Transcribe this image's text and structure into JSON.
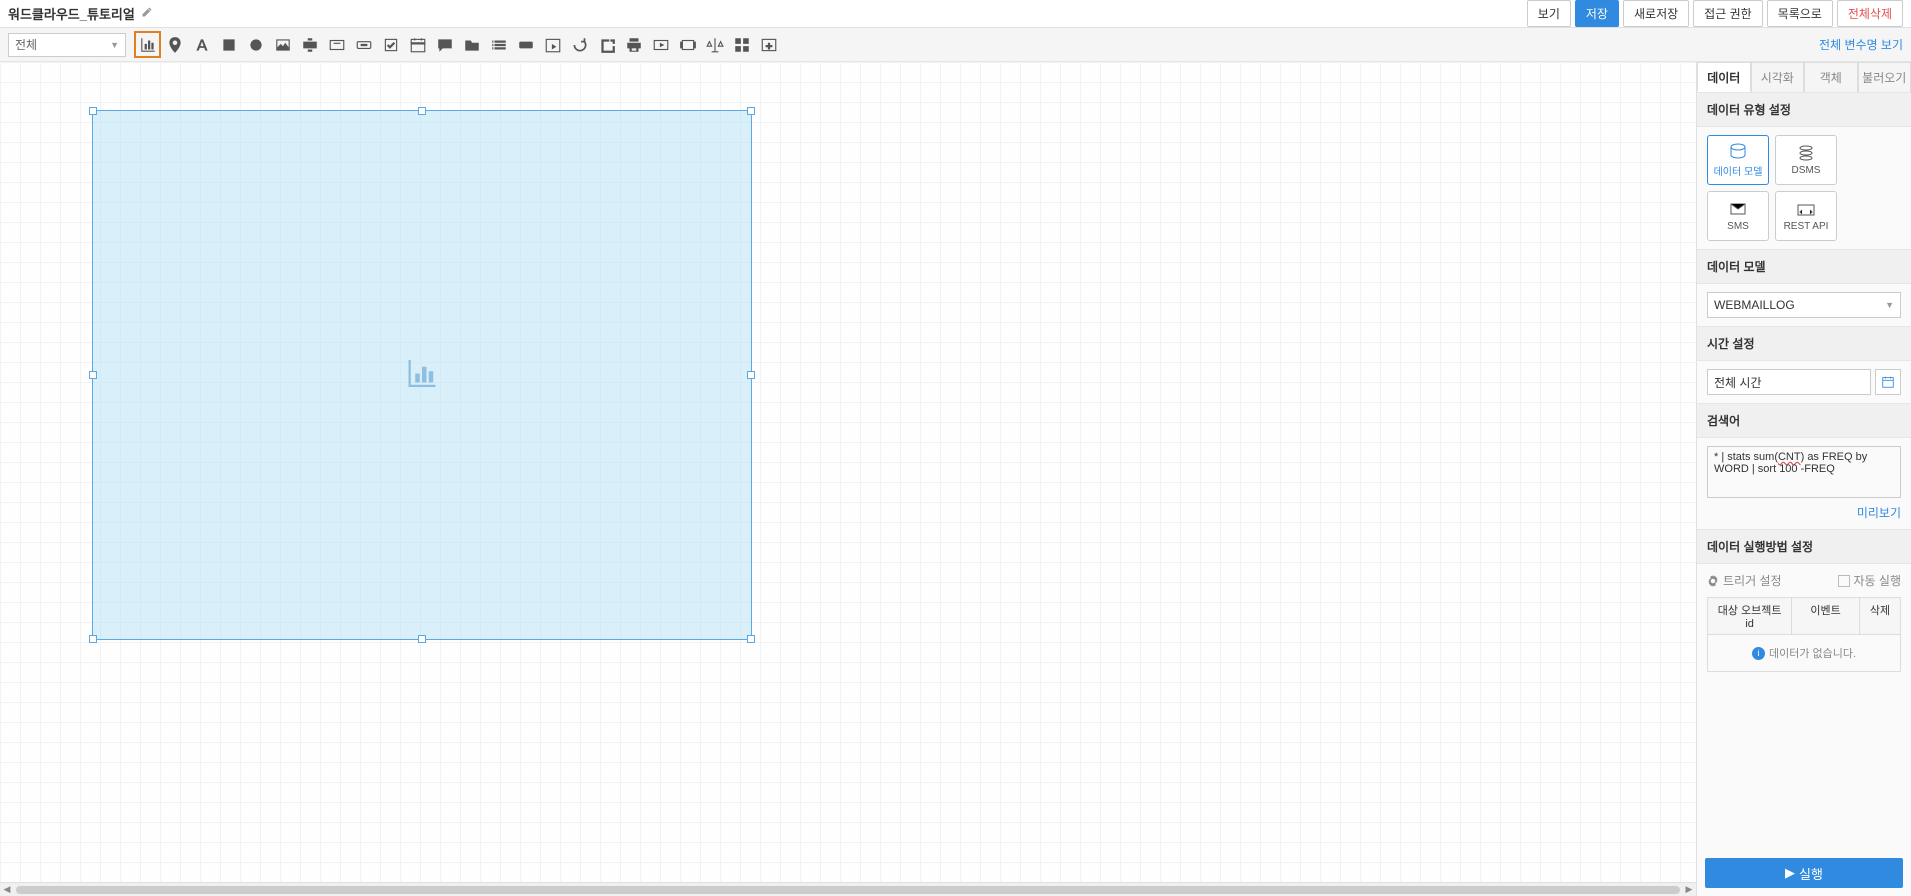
{
  "header": {
    "title": "워드클라우드_튜토리얼",
    "buttons": {
      "view": "보기",
      "save": "저장",
      "save_as": "새로저장",
      "access": "접근 권한",
      "to_list": "목록으로",
      "delete_all": "전체삭제"
    }
  },
  "toolbar": {
    "select_label": "전체",
    "link_right": "전체 변수명 보기"
  },
  "sidebar": {
    "tabs": {
      "data": "데이터",
      "viz": "시각화",
      "object": "객체",
      "import": "불러오기"
    },
    "sec_type": "데이터 유형 설정",
    "tiles": {
      "model": "데이터 모델",
      "dsms": "DSMS",
      "sms": "SMS",
      "rest": "REST API"
    },
    "sec_model": "데이터 모델",
    "model_value": "WEBMAILLOG",
    "sec_time": "시간 설정",
    "time_value": "전체 시간",
    "sec_query": "검색어",
    "query_pre": "* | stats sum(",
    "query_cnt": "CNT",
    "query_post": ") as FREQ by WORD | sort 100 -FREQ",
    "preview": "미리보기",
    "sec_exec": "데이터 실행방법 설정",
    "trigger": "트리거 설정",
    "auto": "자동 실행",
    "grid": {
      "c1": "대상 오브젝트 id",
      "c2": "이벤트",
      "c3": "삭제",
      "empty": "데이터가 없습니다."
    },
    "run": "실행"
  }
}
